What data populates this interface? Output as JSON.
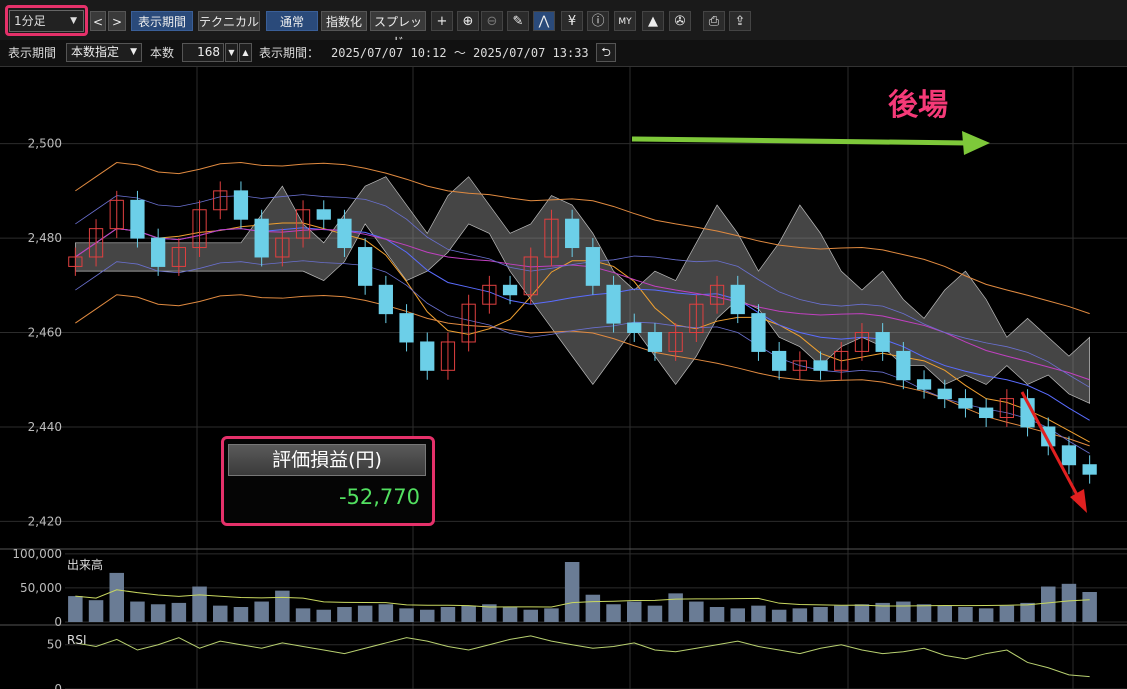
{
  "toolbar": {
    "timeframe": "1分足",
    "prev_label": "<",
    "next_label": ">",
    "period_label": "表示期間",
    "technical_label": "テクニカル",
    "normal_label": "通常",
    "index_label": "指数化",
    "spread_label": "スプレッド",
    "icons": [
      "crosshair-icon",
      "zoom-in-icon",
      "zoom-out-icon",
      "pencil-icon",
      "chart-pattern-icon",
      "yen-icon",
      "info-icon",
      "my-indicator-icon",
      "area-chart-icon",
      "wrench-icon",
      "print-icon",
      "export-icon"
    ]
  },
  "period_bar": {
    "label": "表示期間",
    "mode": "本数指定",
    "count_label": "本数",
    "count": "168",
    "range_label": "表示期間：",
    "range": "2025/07/07 10:12 〜 2025/07/07 13:33"
  },
  "annotations": {
    "afternoon_label": "後場",
    "pnl_title": "評価損益(円)",
    "pnl_value": "-52,770",
    "highlight_color": "#e5316a",
    "arrow_green": "#7ec83a",
    "arrow_red": "#e02020"
  },
  "chart_data": [
    {
      "type": "candlestick",
      "yticks": [
        "2,500",
        "2,480",
        "2,460",
        "2,440",
        "2,420"
      ],
      "ylim": [
        2415,
        2512
      ],
      "close": [
        2476,
        2482,
        2488,
        2480,
        2474,
        2478,
        2486,
        2490,
        2484,
        2476,
        2480,
        2486,
        2484,
        2478,
        2470,
        2464,
        2458,
        2452,
        2458,
        2466,
        2470,
        2468,
        2476,
        2484,
        2478,
        2470,
        2462,
        2460,
        2456,
        2460,
        2466,
        2470,
        2464,
        2456,
        2452,
        2454,
        2452,
        2456,
        2460,
        2456,
        2450,
        2448,
        2446,
        2444,
        2442,
        2446,
        2440,
        2436,
        2432,
        2430
      ],
      "colors": {
        "up": "#e04040",
        "down": "#6ccfe8",
        "cloud": "#9a9a9a"
      }
    },
    {
      "type": "bar",
      "label": "出来高",
      "yticks": [
        "100,000",
        "50,000",
        "0"
      ],
      "ylim": [
        0,
        110000
      ],
      "values": [
        38000,
        32000,
        72000,
        30000,
        26000,
        28000,
        52000,
        24000,
        22000,
        30000,
        46000,
        20000,
        18000,
        22000,
        24000,
        26000,
        20000,
        18000,
        22000,
        24000,
        26000,
        22000,
        18000,
        20000,
        88000,
        40000,
        26000,
        30000,
        24000,
        42000,
        30000,
        22000,
        20000,
        24000,
        18000,
        20000,
        22000,
        24000,
        26000,
        28000,
        30000,
        26000,
        24000,
        22000,
        20000,
        24000,
        28000,
        52000,
        56000,
        44000
      ]
    },
    {
      "type": "line",
      "label": "RSI",
      "yticks": [
        "50",
        "0"
      ],
      "ylim": [
        0,
        70
      ],
      "values": [
        52,
        48,
        56,
        44,
        50,
        58,
        46,
        54,
        50,
        46,
        52,
        48,
        44,
        40,
        46,
        52,
        58,
        54,
        48,
        44,
        50,
        56,
        60,
        54,
        50,
        46,
        48,
        52,
        44,
        42,
        46,
        50,
        54,
        48,
        44,
        40,
        46,
        50,
        44,
        40,
        42,
        46,
        38,
        34,
        40,
        44,
        30,
        24,
        16,
        14
      ]
    }
  ]
}
